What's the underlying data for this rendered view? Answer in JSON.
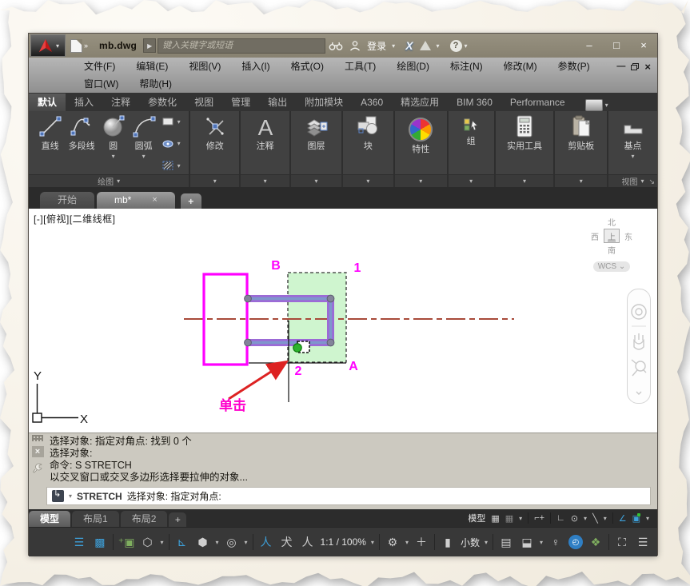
{
  "titlebar": {
    "doc_title": "mb.dwg",
    "search_placeholder": "键入关键字或短语",
    "signin": "登录",
    "minimize": "–",
    "maximize": "□",
    "close": "×",
    "help_mark": "?"
  },
  "menu": {
    "row1": [
      "文件(F)",
      "编辑(E)",
      "视图(V)",
      "插入(I)",
      "格式(O)",
      "工具(T)",
      "绘图(D)",
      "标注(N)",
      "修改(M)",
      "参数(P)"
    ],
    "row2": [
      "窗口(W)",
      "帮助(H)"
    ],
    "doc_close": "×"
  },
  "ribbon": {
    "tabs": [
      "默认",
      "插入",
      "注释",
      "参数化",
      "视图",
      "管理",
      "输出",
      "附加模块",
      "A360",
      "精选应用",
      "BIM 360",
      "Performance"
    ],
    "draw": {
      "buttons": [
        "直线",
        "多段线",
        "圆",
        "圆弧"
      ],
      "footer": "绘图"
    },
    "panels": [
      "修改",
      "注释",
      "图层",
      "块",
      "特性",
      "组",
      "实用工具",
      "剪贴板",
      "基点"
    ],
    "view_footer": "视图"
  },
  "file_tabs": {
    "start": "开始",
    "doc": "mb*",
    "close": "×",
    "plus": "+"
  },
  "viewport": {
    "label": "[-][俯视][二维线框]",
    "viewcube": {
      "n": "北",
      "w": "西",
      "e": "东",
      "s": "南",
      "top": "上",
      "wcs": "WCS"
    }
  },
  "drawing": {
    "labels": {
      "b": "B",
      "one": "1",
      "two": "2",
      "a": "A",
      "click": "单击"
    },
    "axes": {
      "x": "X",
      "y": "Y"
    },
    "colors": {
      "magenta": "#ff00ff",
      "purple": "#9c6ad6",
      "centerline": "#a84a3a",
      "selection_fill": "#c7f3c7",
      "arrow_red": "#dd2222",
      "pickbox_green": "#2db32d"
    }
  },
  "command": {
    "lines": [
      "选择对象: 指定对角点: 找到 0 个",
      "选择对象:",
      "命令: S STRETCH",
      "以交叉窗口或交叉多边形选择要拉伸的对象..."
    ],
    "active_verb": "STRETCH",
    "active_text": "选择对象: 指定对角点:"
  },
  "layout_tabs": {
    "model": "模型",
    "layout1": "布局1",
    "layout2": "布局2",
    "plus": "+"
  },
  "statusbar": {
    "model": "模型",
    "scale": "1:1 / 100%",
    "units": "小数"
  }
}
